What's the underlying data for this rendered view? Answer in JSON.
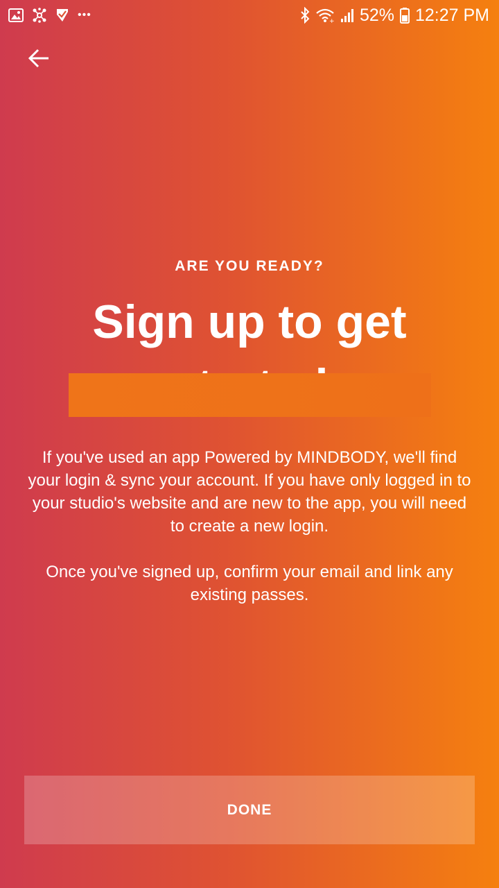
{
  "status_bar": {
    "notification_icons": [
      "image-icon",
      "network-hub-icon",
      "checkmark-app-icon",
      "more-dots-icon"
    ],
    "more_dots": "•••",
    "battery_percent": "52%",
    "time": "12:27 PM"
  },
  "header": {
    "back_icon": "back-arrow-icon"
  },
  "main": {
    "eyebrow": "ARE YOU READY?",
    "headline_line1": "Sign up to get",
    "headline_line2": "started",
    "paragraph1": "If you've used an app Powered by MINDBODY, we'll find your login & sync your account. If you have only logged in to your studio's website and are new to the app, you will need to create a new login.",
    "paragraph2": "Once you've signed up, confirm your email and link any existing passes."
  },
  "footer": {
    "done_label": "DONE"
  },
  "colors": {
    "gradient_start": "#cf3b4e",
    "gradient_end": "#f5800f",
    "text": "#ffffff"
  }
}
